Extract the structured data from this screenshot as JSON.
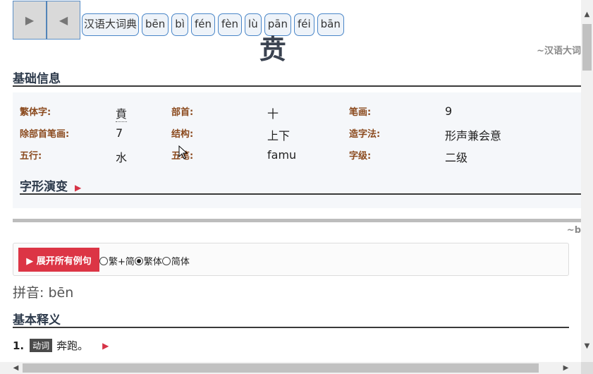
{
  "nav": {
    "forward_icon": "play-right-icon",
    "back_icon": "play-left-icon",
    "tabs": [
      "汉语大词典",
      "bēn",
      "bì",
      "fén",
      "fèn",
      "lù",
      "pān",
      "féi",
      "bān"
    ]
  },
  "entry": {
    "character": "贲",
    "source": "~汉语大词",
    "source2": "~b"
  },
  "basic_info": {
    "title": "基础信息",
    "rows": [
      [
        {
          "label": "繁体字:",
          "value": "賁"
        },
        {
          "label": "部首:",
          "value": "十"
        },
        {
          "label": "笔画:",
          "value": "9"
        }
      ],
      [
        {
          "label": "除部首笔画:",
          "value": "7"
        },
        {
          "label": "结构:",
          "value": "上下"
        },
        {
          "label": "造字法:",
          "value": "形声兼会意"
        }
      ],
      [
        {
          "label": "五行:",
          "value": "水"
        },
        {
          "label": "五笔:",
          "value": "famu"
        },
        {
          "label": "字级:",
          "value": "二级"
        }
      ]
    ],
    "evolution_title": "字形演变"
  },
  "toolbar": {
    "expand_label": "▶ 展开所有例句",
    "options": [
      {
        "label": "繁+简",
        "selected": false
      },
      {
        "label": "繁体",
        "selected": true
      },
      {
        "label": "简体",
        "selected": false
      }
    ]
  },
  "pinyin": "拼音: bēn",
  "definitions": {
    "title": "基本释义",
    "items": [
      {
        "num": "1.",
        "pos": "动词",
        "text": "奔跑。"
      }
    ]
  },
  "colors": {
    "accent_red": "#dc3545",
    "label_brown": "#8b4a1e",
    "heading": "#2d3a4b"
  }
}
